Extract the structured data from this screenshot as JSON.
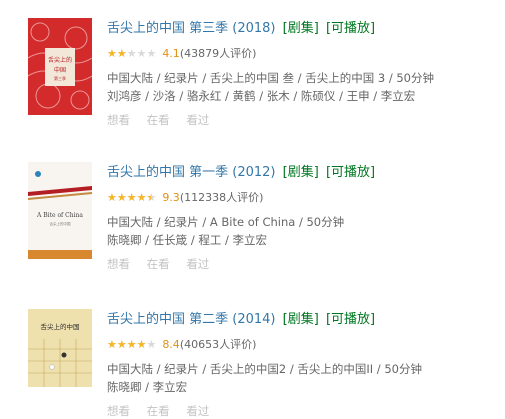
{
  "results": [
    {
      "title": "舌尖上的中国 第三季",
      "year": "(2018)",
      "tags": [
        "[剧集]",
        "[可播放]"
      ],
      "rating": {
        "stars": 2,
        "score": "4.1",
        "count": "(43879人评价)"
      },
      "meta_line1": "中国大陆 / 纪录片 / 舌尖上的中国 叁 / 舌尖上的中国 3 / 50分钟",
      "meta_line2": "刘鸿彦 / 沙洛 / 骆永红 / 黄鹤 / 张木 / 陈硕仪 / 王申 / 李立宏",
      "actions": [
        "想看",
        "在看",
        "看过"
      ],
      "poster": {
        "bg": "#d8282a",
        "label": "舌尖上的中国"
      }
    },
    {
      "title": "舌尖上的中国 第一季",
      "year": "(2012)",
      "tags": [
        "[剧集]",
        "[可播放]"
      ],
      "rating": {
        "stars": 4.5,
        "score": "9.3",
        "count": "(112338人评价)"
      },
      "meta_line1": "中国大陆 / 纪录片 / A Bite of China / 50分钟",
      "meta_line2": "陈晓卿 / 任长箴 / 程工 / 李立宏",
      "actions": [
        "想看",
        "在看",
        "看过"
      ],
      "poster": {
        "bg": "#f6f3ee",
        "label": "A Bite of China"
      }
    },
    {
      "title": "舌尖上的中国 第二季",
      "year": "(2014)",
      "tags": [
        "[剧集]",
        "[可播放]"
      ],
      "rating": {
        "stars": 4,
        "score": "8.4",
        "count": "(40653人评价)"
      },
      "meta_line1": "中国大陆 / 纪录片 / 舌尖上的中国2 / 舌尖上的中国II / 50分钟",
      "meta_line2": "陈晓卿 / 李立宏",
      "actions": [
        "想看",
        "在看",
        "看过"
      ],
      "poster": {
        "bg": "#efe2b0",
        "label": "舌尖上的中国"
      }
    }
  ]
}
